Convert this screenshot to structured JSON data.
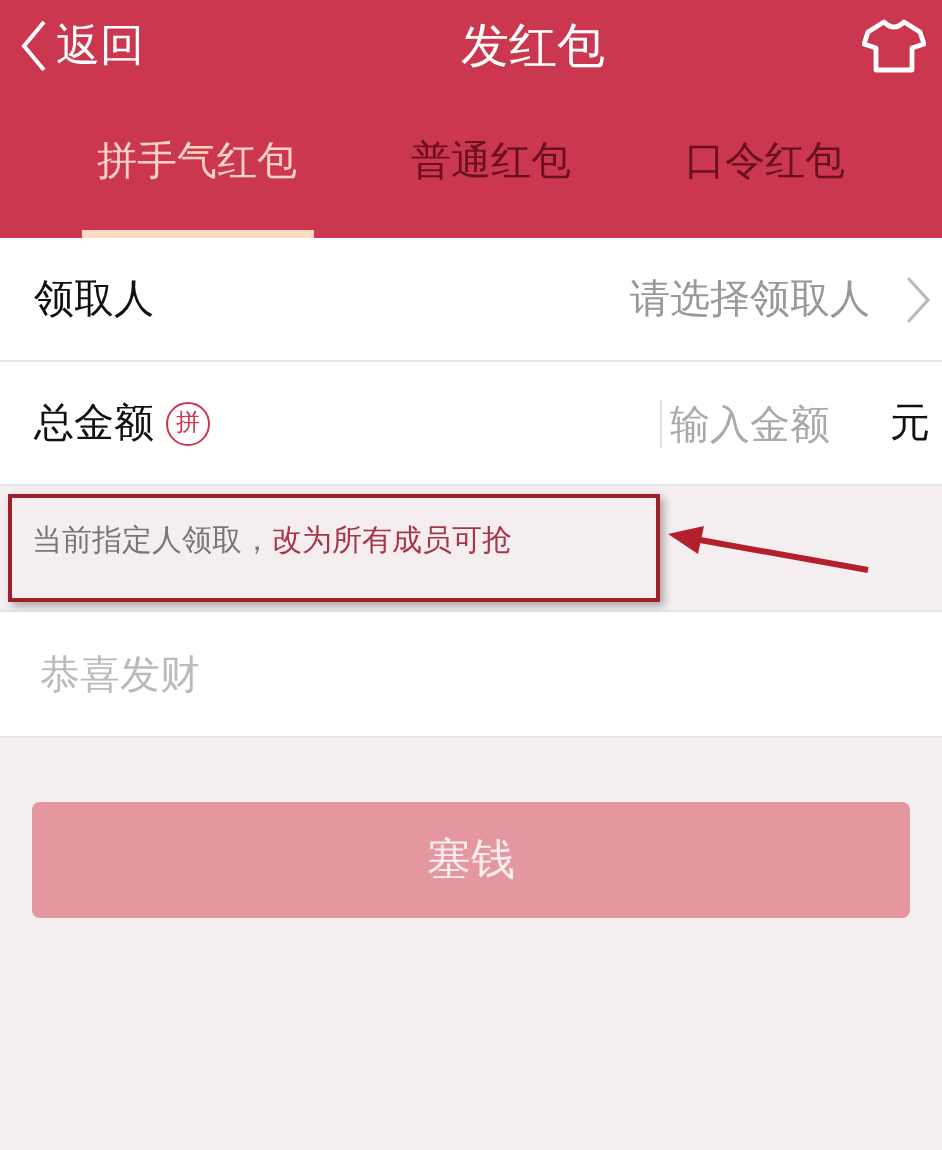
{
  "nav": {
    "back": "返回",
    "title": "发红包"
  },
  "tabs": [
    {
      "label": "拼手气红包",
      "selected": true
    },
    {
      "label": "普通红包",
      "selected": false
    },
    {
      "label": "口令红包",
      "selected": false
    }
  ],
  "recipient": {
    "label": "领取人",
    "placeholder": "请选择领取人"
  },
  "amount": {
    "label": "总金额",
    "badge": "拼",
    "placeholder": "输入金额",
    "unit": "元"
  },
  "note": {
    "text": "当前指定人领取，",
    "link": "改为所有成员可抢"
  },
  "greeting": {
    "placeholder": "恭喜发财"
  },
  "submit": {
    "label": "塞钱",
    "disabled": true
  }
}
